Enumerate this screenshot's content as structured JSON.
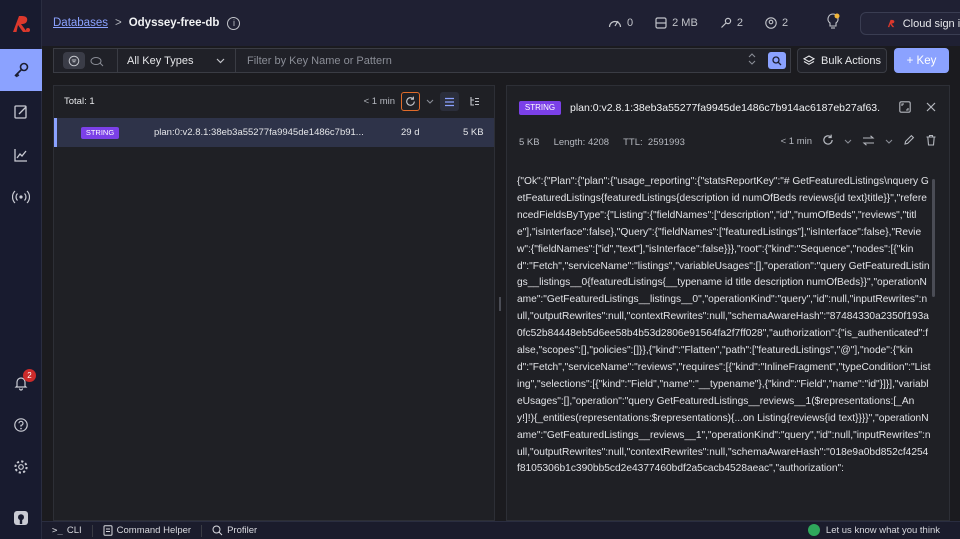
{
  "header": {
    "breadcrumb_link": "Databases",
    "breadcrumb_sep": ">",
    "db_name": "Odyssey-free-db",
    "info": "i",
    "stats": {
      "ops": "0",
      "memory": "2 MB",
      "keys": "2",
      "clients": "2"
    },
    "cloud_signin": "Cloud sign in"
  },
  "sidebar": {
    "notifications_count": "2"
  },
  "filter": {
    "key_type": "All Key Types",
    "search_placeholder": "Filter by Key Name or Pattern",
    "search_value": ""
  },
  "toolbar": {
    "bulk_actions": "Bulk Actions",
    "add_key": "+ Key"
  },
  "list": {
    "total": "Total: 1",
    "last_refresh": "< 1 min",
    "rows": [
      {
        "type": "STRING",
        "name": "plan:0:v2.8.1:38eb3a55277fa9945de1486c7b91...",
        "ttl": "29 d",
        "size": "5 KB"
      }
    ]
  },
  "details": {
    "type": "STRING",
    "name": "plan:0:v2.8.1:38eb3a55277fa9945de1486c7b914ac6187eb27af63...",
    "size": "5 KB",
    "length": "Length: 4208",
    "ttl_label": "TTL:",
    "ttl_value": "2591993",
    "last_refresh": "< 1 min",
    "value": "{\"Ok\":{\"Plan\":{\"plan\":{\"usage_reporting\":{\"statsReportKey\":\"# GetFeaturedListings\\nquery GetFeaturedListings{featuredListings{description id numOfBeds reviews{id text}title}}\",\"referencedFieldsByType\":{\"Listing\":{\"fieldNames\":[\"description\",\"id\",\"numOfBeds\",\"reviews\",\"title\"],\"isInterface\":false},\"Query\":{\"fieldNames\":[\"featuredListings\"],\"isInterface\":false},\"Review\":{\"fieldNames\":[\"id\",\"text\"],\"isInterface\":false}}},\"root\":{\"kind\":\"Sequence\",\"nodes\":[{\"kind\":\"Fetch\",\"serviceName\":\"listings\",\"variableUsages\":[],\"operation\":\"query GetFeaturedListings__listings__0{featuredListings{__typename id title description numOfBeds}}\",\"operationName\":\"GetFeaturedListings__listings__0\",\"operationKind\":\"query\",\"id\":null,\"inputRewrites\":null,\"outputRewrites\":null,\"contextRewrites\":null,\"schemaAwareHash\":\"87484330a2350f193a0fc52b84448eb5d6ee58b4b53d2806e91564fa2f7ff028\",\"authorization\":{\"is_authenticated\":false,\"scopes\":[],\"policies\":[]}},{\"kind\":\"Flatten\",\"path\":[\"featuredListings\",\"@\"],\"node\":{\"kind\":\"Fetch\",\"serviceName\":\"reviews\",\"requires\":[{\"kind\":\"InlineFragment\",\"typeCondition\":\"Listing\",\"selections\":[{\"kind\":\"Field\",\"name\":\"__typename\"},{\"kind\":\"Field\",\"name\":\"id\"}]}],\"variableUsages\":[],\"operation\":\"query GetFeaturedListings__reviews__1($representations:[_Any!]!){_entities(representations:$representations){...on Listing{reviews{id text}}}}\",\"operationName\":\"GetFeaturedListings__reviews__1\",\"operationKind\":\"query\",\"id\":null,\"inputRewrites\":null,\"outputRewrites\":null,\"contextRewrites\":null,\"schemaAwareHash\":\"018e9a0bd852cf4254f8105306b1c390bb5cd2e4377460bdf2a5cacb4528aeac\",\"authorization\":"
  },
  "bottombar": {
    "cli": "CLI",
    "command_helper": "Command Helper",
    "profiler": "Profiler",
    "feedback": "Let us know what you think"
  },
  "colors": {
    "accent": "#8ba2ff",
    "string_tag": "#7b40e8",
    "logo": "#dc382c",
    "highlight": "#e06b2a"
  }
}
